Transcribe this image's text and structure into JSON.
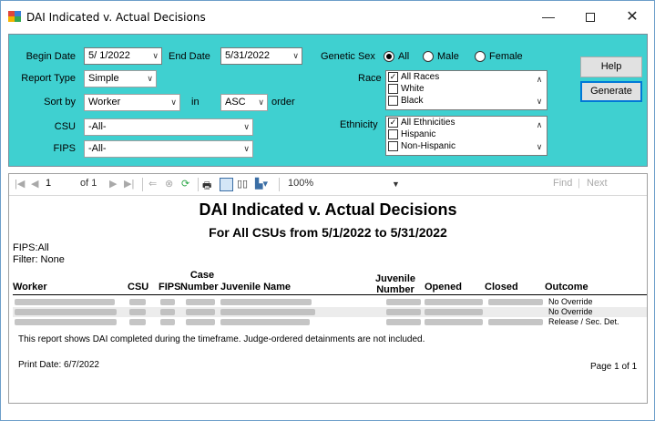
{
  "window": {
    "title": "DAI Indicated v. Actual Decisions",
    "min_glyph": "—",
    "max_glyph": "",
    "close_glyph": "✕"
  },
  "filters": {
    "begin_date_label": "Begin Date",
    "begin_date_value": "5/  1/2022",
    "end_date_label": "End Date",
    "end_date_value": "5/31/2022",
    "report_type_label": "Report Type",
    "report_type_value": "Simple",
    "sort_by_label": "Sort by",
    "sort_by_value": "Worker",
    "in_label": "in",
    "order_value": "ASC",
    "order_label": "order",
    "csu_label": "CSU",
    "csu_value": "-All-",
    "fips_label": "FIPS",
    "fips_value": "-All-",
    "genetic_sex_label": "Genetic Sex",
    "sex_options": [
      "All",
      "Male",
      "Female"
    ],
    "sex_selected": "All",
    "race_label": "Race",
    "race_items": [
      {
        "label": "All Races",
        "checked": true
      },
      {
        "label": "White",
        "checked": false
      },
      {
        "label": "Black",
        "checked": false
      }
    ],
    "ethnicity_label": "Ethnicity",
    "ethnicity_items": [
      {
        "label": "All Ethnicities",
        "checked": true
      },
      {
        "label": "Hispanic",
        "checked": false
      },
      {
        "label": "Non-Hispanic",
        "checked": false
      }
    ],
    "help_label": "Help",
    "generate_label": "Generate"
  },
  "toolbar": {
    "page_value": "1",
    "of_pages": "of 1",
    "zoom_value": "100%",
    "find_label": "Find",
    "find_sep": "|",
    "next_label": "Next"
  },
  "report": {
    "title": "DAI Indicated v. Actual Decisions",
    "subtitle": "For All CSUs  from  5/1/2022  to  5/31/2022",
    "fips_line": "FIPS:All",
    "filter_line": "Filter: None",
    "columns": {
      "worker": "Worker",
      "csu": "CSU",
      "fips": "FIPS",
      "case_number_1": "Case",
      "case_number_2": "Number",
      "juvenile_name": "Juvenile Name",
      "juvenile_number_1": "Juvenile",
      "juvenile_number_2": "Number",
      "opened": "Opened",
      "closed": "Closed",
      "outcome": "Outcome"
    },
    "rows": [
      {
        "outcome": "No Override"
      },
      {
        "outcome": "No Override"
      },
      {
        "outcome": "Release / Sec. Det."
      }
    ],
    "footnote": "This report shows DAI completed during the timeframe. Judge-ordered detainments are not included.",
    "print_date": "Print Date: 6/7/2022",
    "page_info": "Page 1 of 1"
  }
}
